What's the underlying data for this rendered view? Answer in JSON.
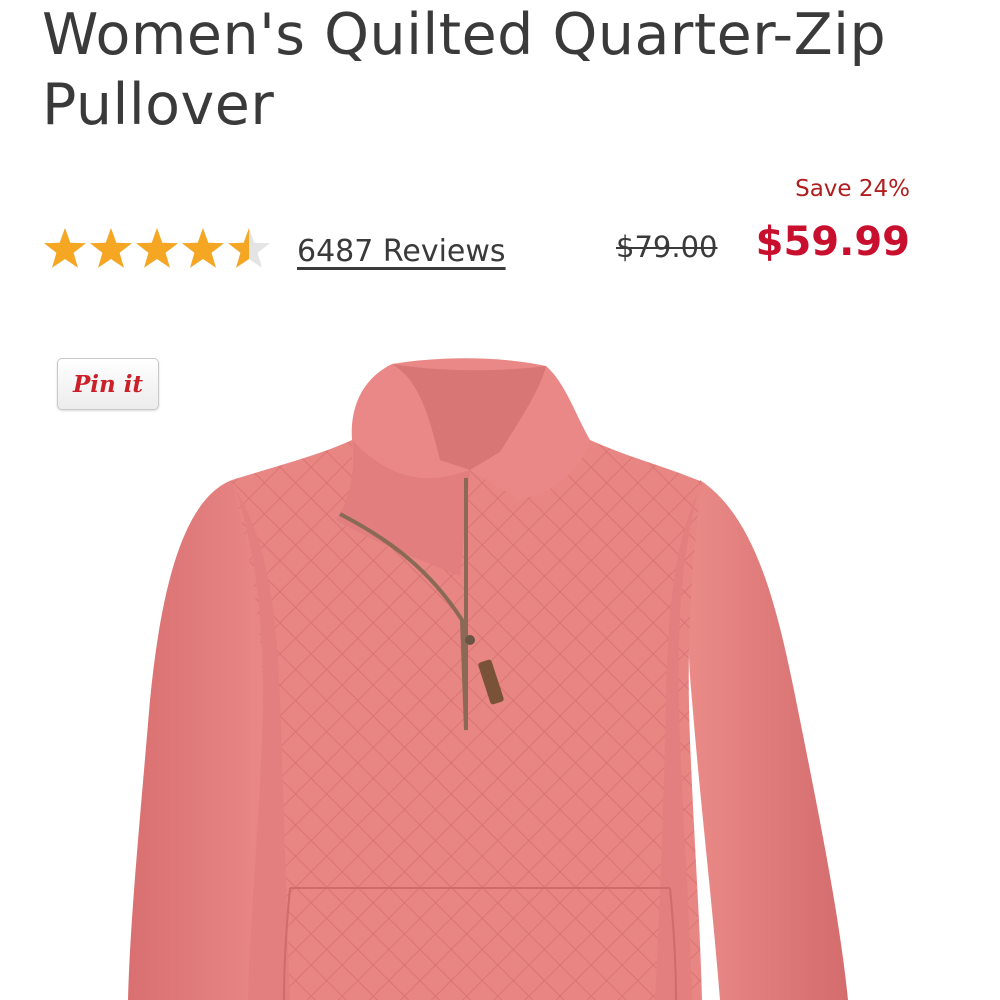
{
  "product": {
    "title": "Women's Quilted Quarter-Zip Pullover",
    "rating": 4.5,
    "rating_max": 5,
    "reviews_label": "6487 Reviews",
    "save_label": "Save 24%",
    "original_price": "$79.00",
    "sale_price": "$59.99",
    "pin_label": "Pin it",
    "image_icon": "pink-quilted-pullover-photo"
  },
  "colors": {
    "star": "#f5a623",
    "sale": "#c8102e",
    "pullover": "#e88684",
    "pin_red": "#cb2027"
  }
}
